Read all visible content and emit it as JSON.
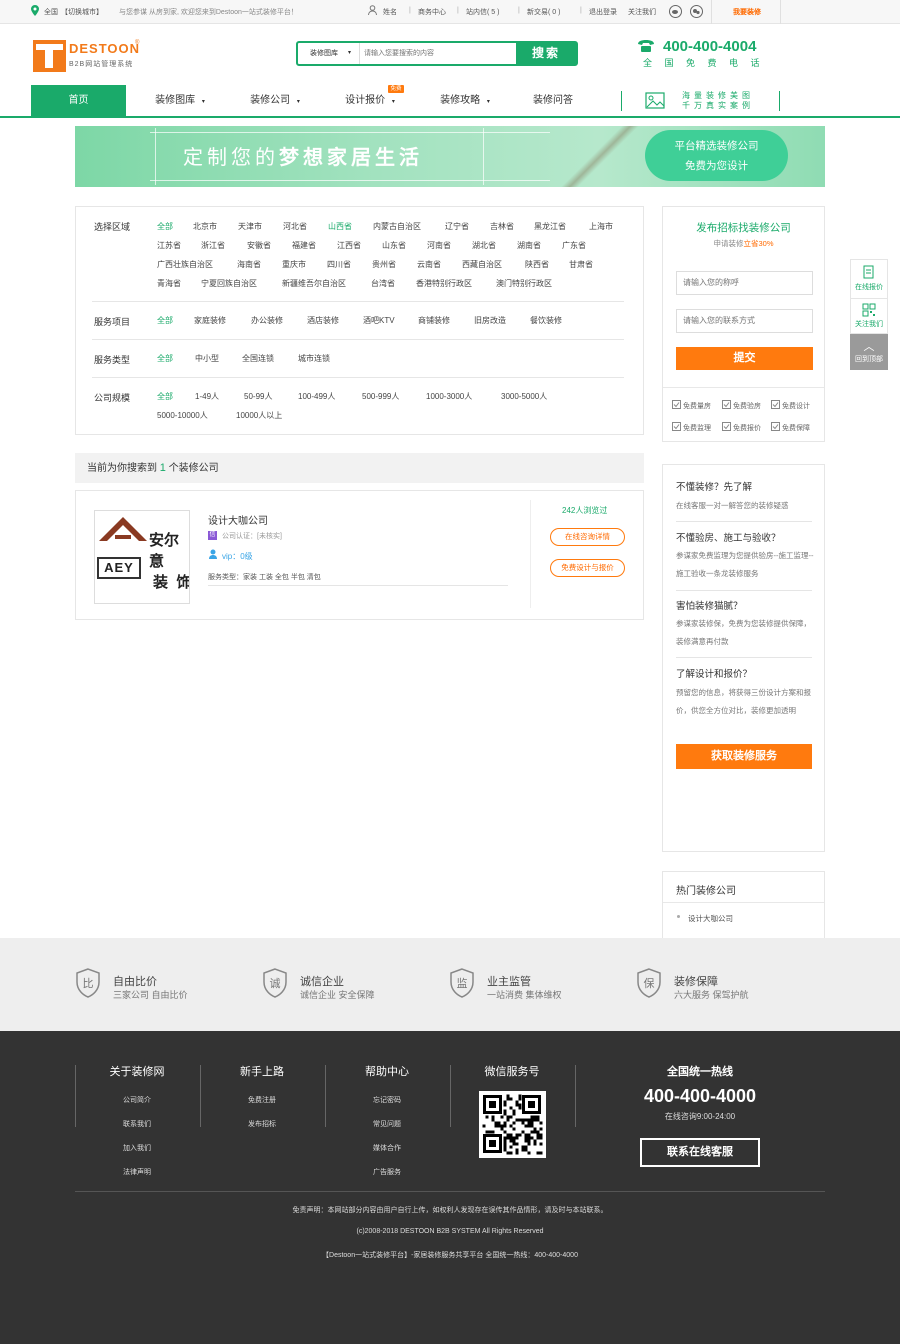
{
  "topbar": {
    "region": "全国",
    "switch_city": "【切换城市】",
    "welcome": "与您参谋  从房到家, 欢迎您来到Destoon一站式装修平台！",
    "username": "姓名",
    "biz_center": "商务中心",
    "inbox": "站内信(",
    "inbox_count": "5",
    "inbox_close": ")",
    "new_trade": "新交易(",
    "new_trade_count": "0",
    "new_trade_close": ")",
    "logout": "退出登录",
    "follow": "关注我们",
    "want_decor": "我要装修",
    "seps": [
      "|",
      "|",
      "|",
      "|"
    ]
  },
  "logo": {
    "brand": "DESTOON",
    "sub": "B2B网站管理系统",
    "mark": "T",
    "reg": "®"
  },
  "search": {
    "category": "装修图库",
    "placeholder": "请输入您要搜索的内容",
    "button": "搜索"
  },
  "hotline_header": {
    "number": "400-400-4004",
    "label": "全 国 免 费 电 话"
  },
  "nav": {
    "items": [
      "首页",
      "装修图库",
      "装修公司",
      "设计报价",
      "装修攻略",
      "装修问答"
    ],
    "badge": "免费",
    "promo_line1": "海量装修美图",
    "promo_line2": "千万真实案例"
  },
  "banner": {
    "slogan_part1": "定制您的",
    "slogan_part2": "梦想家居生活",
    "cta_line1": "平台精选装修公司",
    "cta_line2": "免费为您设计"
  },
  "filters": {
    "region": {
      "label": "选择区域",
      "options": [
        "全部",
        "北京市",
        "天津市",
        "河北省",
        "山西省",
        "内蒙古自治区",
        "辽宁省",
        "吉林省",
        "黑龙江省",
        "上海市",
        "江苏省",
        "浙江省",
        "安徽省",
        "福建省",
        "江西省",
        "山东省",
        "河南省",
        "湖北省",
        "湖南省",
        "广东省",
        "广西壮族自治区",
        "海南省",
        "重庆市",
        "四川省",
        "贵州省",
        "云南省",
        "西藏自治区",
        "陕西省",
        "甘肃省",
        "青海省",
        "宁夏回族自治区",
        "新疆维吾尔自治区",
        "台湾省",
        "香港特别行政区",
        "澳门特别行政区"
      ]
    },
    "service_item": {
      "label": "服务项目",
      "options": [
        "全部",
        "家庭装修",
        "办公装修",
        "酒店装修",
        "酒吧KTV",
        "商铺装修",
        "旧房改造",
        "餐饮装修"
      ]
    },
    "service_type": {
      "label": "服务类型",
      "options": [
        "全部",
        "中小型",
        "全国连锁",
        "城市连锁"
      ]
    },
    "company_size": {
      "label": "公司规模",
      "options": [
        "全部",
        "1-49人",
        "50-99人",
        "100-499人",
        "500-999人",
        "1000-3000人",
        "3000-5000人",
        "5000-10000人",
        "10000人以上"
      ]
    }
  },
  "results": {
    "prefix": "当前为你搜索到",
    "count": "1",
    "suffix": "个装修公司"
  },
  "company": {
    "logo_cn": "安尔意",
    "logo_cn2": "装  饰",
    "logo_en": "AEY",
    "name": "设计大咖公司",
    "cert_badge": "信",
    "cert": "公司认证：[未核实]",
    "vip": "vip：0级",
    "services": "服务类型：家装 工装 全包 半包 清包",
    "views": "242人浏览过",
    "btn_consult": "在线咨询详情",
    "btn_design": "免费设计与报价"
  },
  "tender": {
    "title": "发布招标找装修公司",
    "subtitle_pre": "申请装修",
    "subtitle_hl": "立省30%",
    "name_placeholder": "请输入您的称呼",
    "contact_placeholder": "请输入您的联系方式",
    "submit": "提交",
    "perks": [
      "免费量房",
      "免费验房",
      "免费设计",
      "免费监理",
      "免费报价",
      "免费保障"
    ]
  },
  "faq": {
    "items": [
      {
        "q": "不懂装修？先了解",
        "a": "在线客服一对一解答您的装修疑惑"
      },
      {
        "q": "不懂验房、施工与验收？",
        "a": "参谋家免费监理为您提供验房--施工监理--施工验收一条龙装修服务"
      },
      {
        "q": "害怕装修猫腻？",
        "a": "参谋家装修保，免费为您装修提供保障，装修满意再付款"
      },
      {
        "q": "了解设计和报价？",
        "a": "预留您的信息，将获得三份设计方案和报价，供您全方位对比，装修更加透明"
      }
    ],
    "button": "获取装修服务"
  },
  "hot": {
    "title": "热门装修公司",
    "items": [
      "设计大咖公司"
    ]
  },
  "float": {
    "quote": "在线报价",
    "follow": "关注我们",
    "top": "回到顶部"
  },
  "features": [
    {
      "char": "比",
      "title": "自由比价",
      "sub": "三家公司 自由比价"
    },
    {
      "char": "诚",
      "title": "诚信企业",
      "sub": "诚信企业 安全保障"
    },
    {
      "char": "监",
      "title": "业主监管",
      "sub": "一站消费 集体维权"
    },
    {
      "char": "保",
      "title": "装修保障",
      "sub": "六大服务 保驾护航"
    }
  ],
  "footer": {
    "cols": [
      {
        "title": "关于装修网",
        "links": [
          "公司简介",
          "联系我们",
          "加入我们",
          "法律声明"
        ]
      },
      {
        "title": "新手上路",
        "links": [
          "免费注册",
          "发布招标"
        ]
      },
      {
        "title": "帮助中心",
        "links": [
          "忘记密码",
          "常见问题",
          "媒体合作",
          "广告服务"
        ]
      }
    ],
    "wechat": "微信服务号",
    "hotline_title": "全国统一热线",
    "hotline": "400-400-4000",
    "hours": "在线咨询9:00-24:00",
    "contact_btn": "联系在线客服",
    "disclaimer": "免责声明：本网站部分内容由用户自行上传，如权利人发现存在误传其作品情形，请及时与本站联系。",
    "copyright": "(c)2008-2018 DESTOON B2B SYSTEM All Rights Reserved",
    "slogan": "【Destoon一站式装修平台】-家居装修服务共享平台 全国统一热线：400-400-4000"
  },
  "colors": {
    "green": "#1aaa6a",
    "orange": "#ff7a0e",
    "footer_bg": "#333333",
    "feature_bg": "#eeeeee"
  }
}
